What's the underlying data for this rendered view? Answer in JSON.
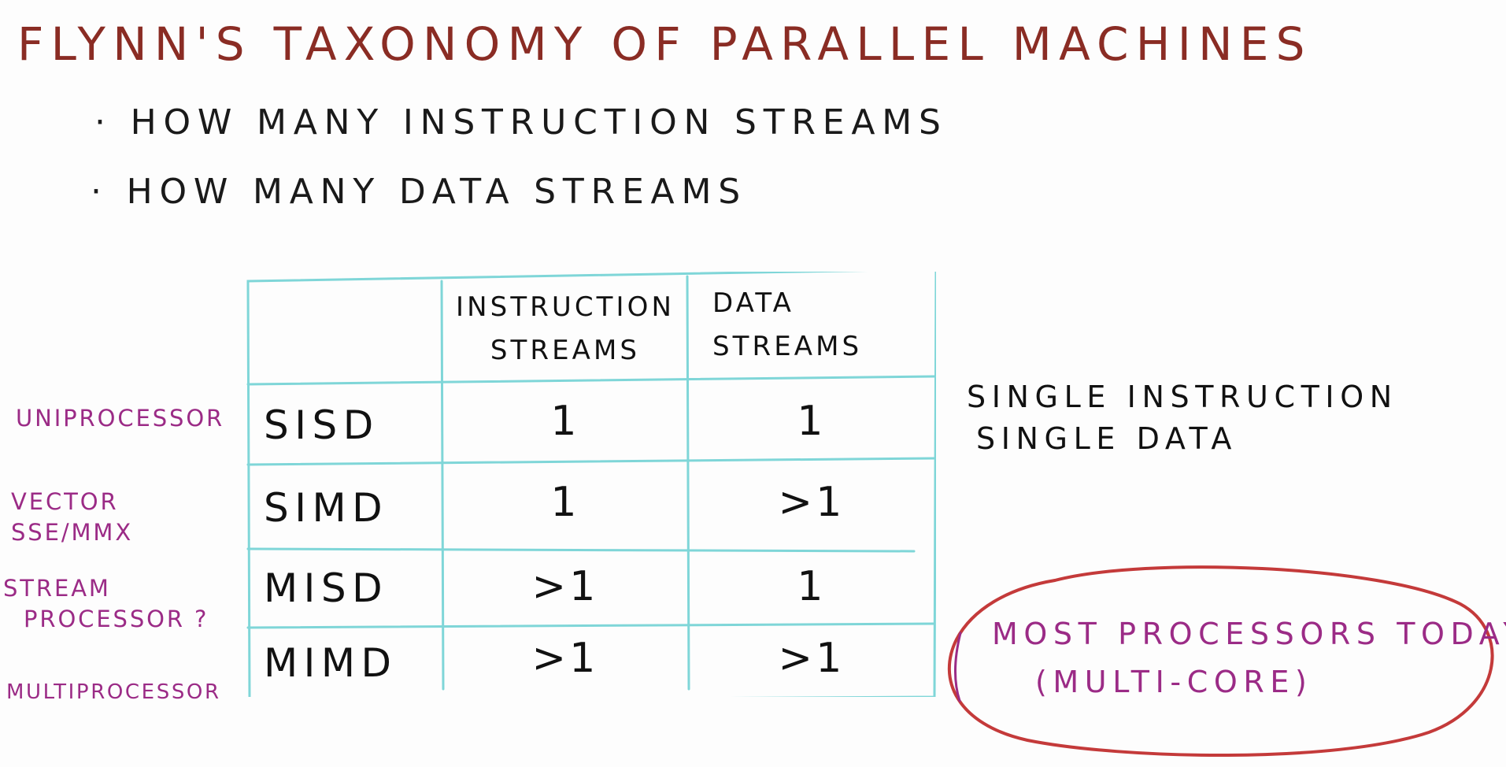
{
  "title": "FLYNN'S TAXONOMY OF PARALLEL MACHINES",
  "bullets": [
    "· HOW MANY INSTRUCTION STREAMS",
    "· HOW MANY DATA STREAMS"
  ],
  "table": {
    "headers": {
      "instruction_line1": "INSTRUCTION",
      "instruction_line2": "STREAMS",
      "data_line1": "DATA",
      "data_line2": "STREAMS"
    },
    "rows": [
      {
        "name": "SISD",
        "instruction": "1",
        "data": "1",
        "left_label": "UNIPROCESSOR"
      },
      {
        "name": "SIMD",
        "instruction": "1",
        "data": ">1",
        "left_label_1": "VECTOR",
        "left_label_2": "SSE/MMX"
      },
      {
        "name": "MISD",
        "instruction": ">1",
        "data": "1",
        "left_label_1": "STREAM",
        "left_label_2": "PROCESSOR ?"
      },
      {
        "name": "MIMD",
        "instruction": ">1",
        "data": ">1",
        "left_label": "MULTIPROCESSOR"
      }
    ]
  },
  "right_note": {
    "line1": "SINGLE INSTRUCTION",
    "line2": "SINGLE DATA"
  },
  "circled_note": {
    "line1": "MOST PROCESSORS TODAY",
    "line2": "(MULTI-CORE)"
  },
  "colors": {
    "title": "#8a2c24",
    "table_lines": "#7fd6d8",
    "side_labels": "#9b2b86",
    "ellipse": "#c43a3a",
    "ink": "#111111"
  }
}
